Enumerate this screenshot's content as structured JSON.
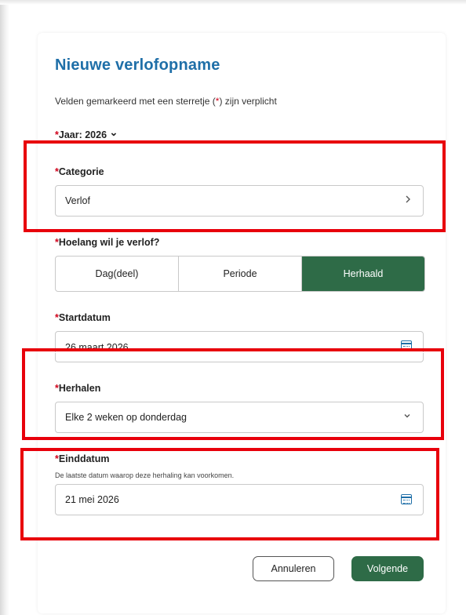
{
  "form": {
    "title": "Nieuwe verlofopname",
    "subtitle_pre": "Velden gemarkeerd met een sterretje (",
    "subtitle_star": "*",
    "subtitle_post": ") zijn verplicht",
    "required_mark": "*",
    "year_label": "Jaar: 2026",
    "year_chevron": "⌄",
    "category": {
      "label": "Categorie",
      "value": "Verlof",
      "icon": "chevron-right-icon"
    },
    "duration": {
      "label": "Hoelang wil je verlof?",
      "options": [
        "Dag(deel)",
        "Periode",
        "Herhaald"
      ],
      "selected": "Herhaald"
    },
    "start_date": {
      "label": "Startdatum",
      "value": "26 maart 2026",
      "icon": "calendar-icon"
    },
    "repeat": {
      "label": "Herhalen",
      "value": "Elke 2 weken op donderdag",
      "icon": "chevron-down-icon"
    },
    "end_date": {
      "label": "Einddatum",
      "hint": "De laatste datum waarop deze herhaling kan voorkomen.",
      "value": "21 mei 2026",
      "icon": "calendar-icon"
    },
    "buttons": {
      "cancel": "Annuleren",
      "next": "Volgende"
    }
  },
  "colors": {
    "accent": "#2e6b47",
    "title": "#1f6fa8",
    "required": "#d0021b",
    "highlight": "#e8000b"
  }
}
